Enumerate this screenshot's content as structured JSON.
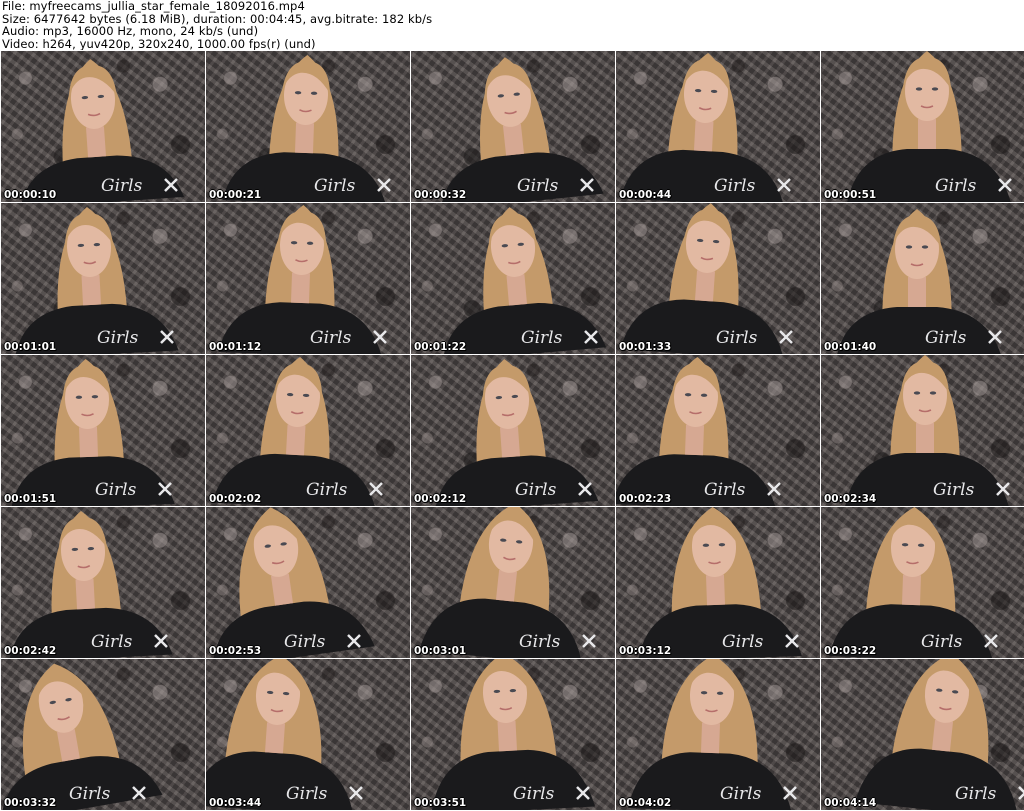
{
  "header": {
    "file_line": "File: myfreecams_jullia_star_female_18092016.mp4",
    "size_line": "Size: 6477642 bytes (6.18 MiB), duration: 00:04:45, avg.bitrate: 182 kb/s",
    "audio_line": "Audio: mp3, 16000 Hz, mono, 24 kb/s (und)",
    "video_line": "Video: h264, yuv420p, 320x240, 1000.00 fps(r) (und)"
  },
  "thumbnails": [
    {
      "time": "00:00:10"
    },
    {
      "time": "00:00:21"
    },
    {
      "time": "00:00:32"
    },
    {
      "time": "00:00:44"
    },
    {
      "time": "00:00:51"
    },
    {
      "time": "00:01:01"
    },
    {
      "time": "00:01:12"
    },
    {
      "time": "00:01:22"
    },
    {
      "time": "00:01:33"
    },
    {
      "time": "00:01:40"
    },
    {
      "time": "00:01:51"
    },
    {
      "time": "00:02:02"
    },
    {
      "time": "00:02:12"
    },
    {
      "time": "00:02:23"
    },
    {
      "time": "00:02:34"
    },
    {
      "time": "00:02:42"
    },
    {
      "time": "00:02:53"
    },
    {
      "time": "00:03:01"
    },
    {
      "time": "00:03:12"
    },
    {
      "time": "00:03:22"
    },
    {
      "time": "00:03:32"
    },
    {
      "time": "00:03:44"
    },
    {
      "time": "00:03:51"
    },
    {
      "time": "00:04:02"
    },
    {
      "time": "00:04:14"
    }
  ],
  "colors": {
    "background": "#ffffff",
    "header_text": "#000000",
    "timestamp_text": "#ffffff",
    "wall": "#55504f",
    "shirt": "#1a1a1c",
    "hair": "#c49a6a",
    "skin": "#e2b9a2"
  },
  "shirt_print": "Girls"
}
